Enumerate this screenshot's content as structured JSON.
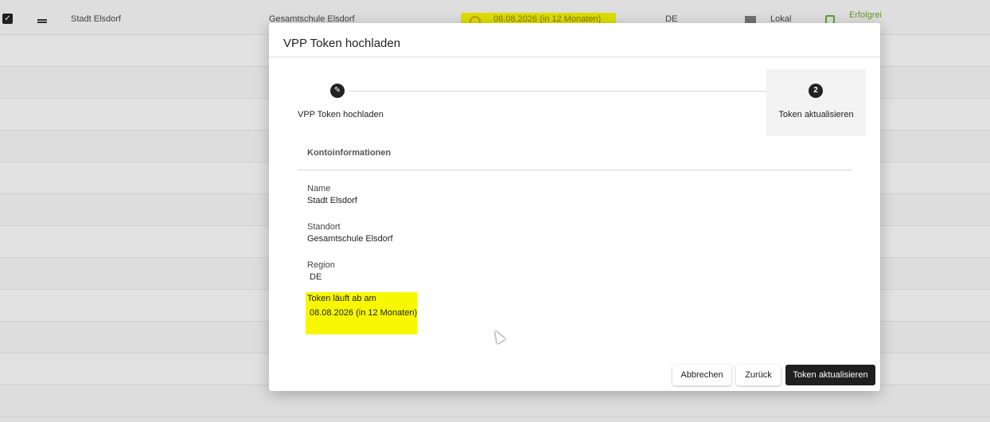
{
  "background_row": {
    "name": "Stadt Elsdorf",
    "location": "Gesamtschule Elsdorf",
    "expiry": "08.08.2026 (in 12 Monaten)",
    "region": "DE",
    "type": "Lokal",
    "status": "Erfolgrei"
  },
  "modal": {
    "title": "VPP Token hochladen",
    "steps": [
      {
        "label": "VPP Token hochladen",
        "icon": "pencil-icon"
      },
      {
        "label": "Token aktualisieren",
        "number": "2"
      }
    ],
    "section_title": "Kontoinformationen",
    "fields": {
      "name_label": "Name",
      "name_value": "Stadt Elsdorf",
      "location_label": "Standort",
      "location_value": "Gesamtschule Elsdorf",
      "region_label": "Region",
      "region_value": "DE",
      "expiry_label": "Token läuft ab am",
      "expiry_value": "08.08.2026 (in 12 Monaten)"
    },
    "buttons": {
      "cancel": "Abbrechen",
      "back": "Zurück",
      "submit": "Token aktualisieren"
    }
  },
  "colors": {
    "highlight": "#f7f700",
    "primary_button": "#1f1f1f"
  }
}
